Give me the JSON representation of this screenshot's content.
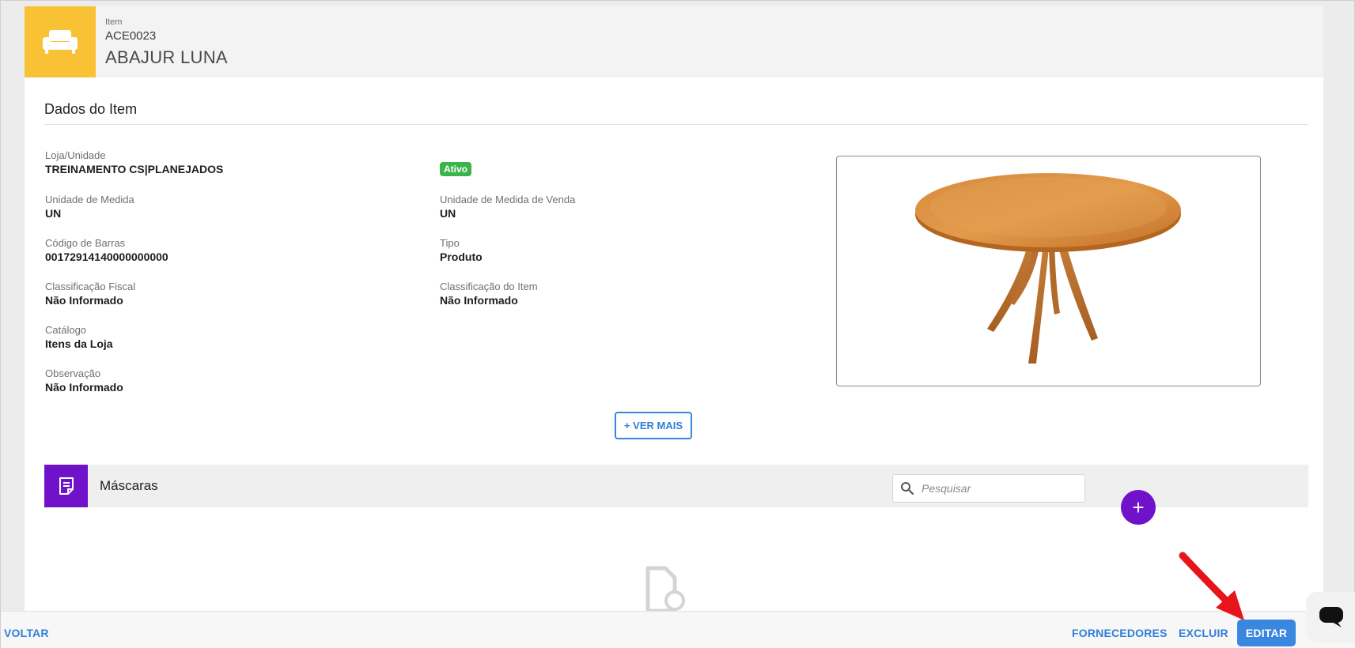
{
  "header": {
    "crumb": "Item",
    "code": "ACE0023",
    "title": "ABAJUR LUNA",
    "icon": "sofa-icon",
    "icon_bg": "#f9c235"
  },
  "details": {
    "section_title": "Dados do Item",
    "status": "Ativo",
    "fields": [
      {
        "label": "Loja/Unidade",
        "value": "TREINAMENTO CS|PLANEJADOS"
      },
      {
        "label": "Unidade de Medida",
        "value": "UN"
      },
      {
        "label": "Unidade de Medida de Venda",
        "value": "UN"
      },
      {
        "label": "Código de Barras",
        "value": "00172914140000000000"
      },
      {
        "label": "Tipo",
        "value": "Produto"
      },
      {
        "label": "Classificação Fiscal",
        "value": "Não Informado"
      },
      {
        "label": "Classificação do Item",
        "value": "Não Informado"
      },
      {
        "label": "Catálogo",
        "value": "Itens da Loja"
      },
      {
        "label": "Observação",
        "value": "Não Informado"
      }
    ],
    "ver_mais": "+ VER MAIS"
  },
  "masks": {
    "title": "Máscaras",
    "search_placeholder": "Pesquisar",
    "add_label": "+",
    "accent": "#6f12c9"
  },
  "footer": {
    "voltar": "VOLTAR",
    "fornecedores": "FORNECEDORES",
    "excluir": "EXCLUIR",
    "editar": "EDITAR"
  }
}
